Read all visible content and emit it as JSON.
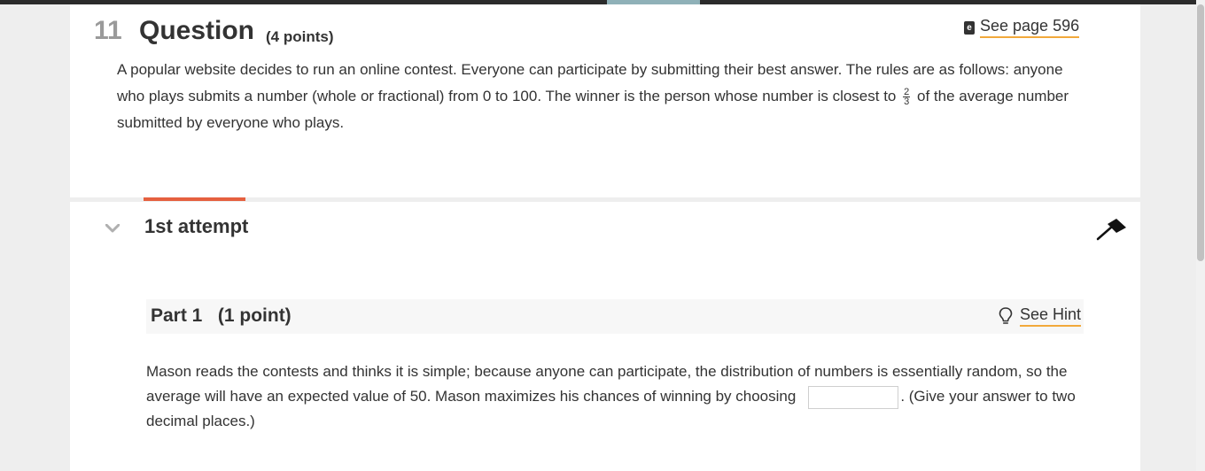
{
  "question": {
    "number": "11",
    "title": "Question",
    "points": "(4 points)",
    "ebook_label": "See page 596",
    "ebook_icon": "ebook-icon",
    "text_before_fraction": "A popular website decides to run an online contest. Everyone can participate by submitting their best answer. The rules are as follows: anyone who plays submits a number (whole or fractional) from 0 to 100. The winner is the person whose number is closest to",
    "fraction": {
      "numerator": "2",
      "denominator": "3"
    },
    "text_after_fraction": "of the average number submitted by everyone who plays."
  },
  "attempt": {
    "label": "1st attempt",
    "chevron_icon": "chevron-down-icon",
    "pin_icon": "pushpin-icon",
    "tab_color": "#e5603f"
  },
  "part": {
    "title": "Part 1   (1 point)",
    "hint_label": "See Hint",
    "hint_icon": "lightbulb-icon",
    "text_before_input": "Mason reads the contests and thinks it is simple; because anyone can participate, the distribution of numbers is essentially random, so the average will have an expected value of 50. Mason maximizes his chances of winning by choosing",
    "answer_value": "",
    "text_after_input": ". (Give your answer to two decimal places.)"
  },
  "colors": {
    "accent_underline": "#f2a93b",
    "top_bar": "#2b2b2b",
    "top_bar_accent": "#8fb1b8"
  }
}
